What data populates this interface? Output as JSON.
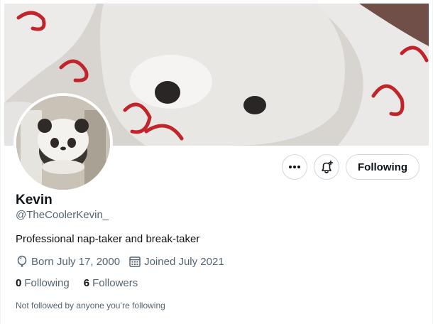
{
  "profile": {
    "name": "Kevin",
    "handle": "@TheCoolerKevin_",
    "bio": "Professional nap-taker and break-taker",
    "born": "Born July 17, 2000",
    "joined": "Joined July 2021",
    "following_count": "0",
    "following_label": "Following",
    "followers_count": "6",
    "followers_label": "Followers",
    "mutual_note": "Not followed by anyone you’re following"
  },
  "actions": {
    "more_icon": "more-horizontal-icon",
    "notify_icon": "bell-plus-icon",
    "follow_label": "Following"
  },
  "icons": {
    "born": "balloon-icon",
    "joined": "calendar-icon"
  },
  "colors": {
    "text_primary": "#0f1419",
    "text_secondary": "#536471",
    "border": "#cfd9de"
  }
}
